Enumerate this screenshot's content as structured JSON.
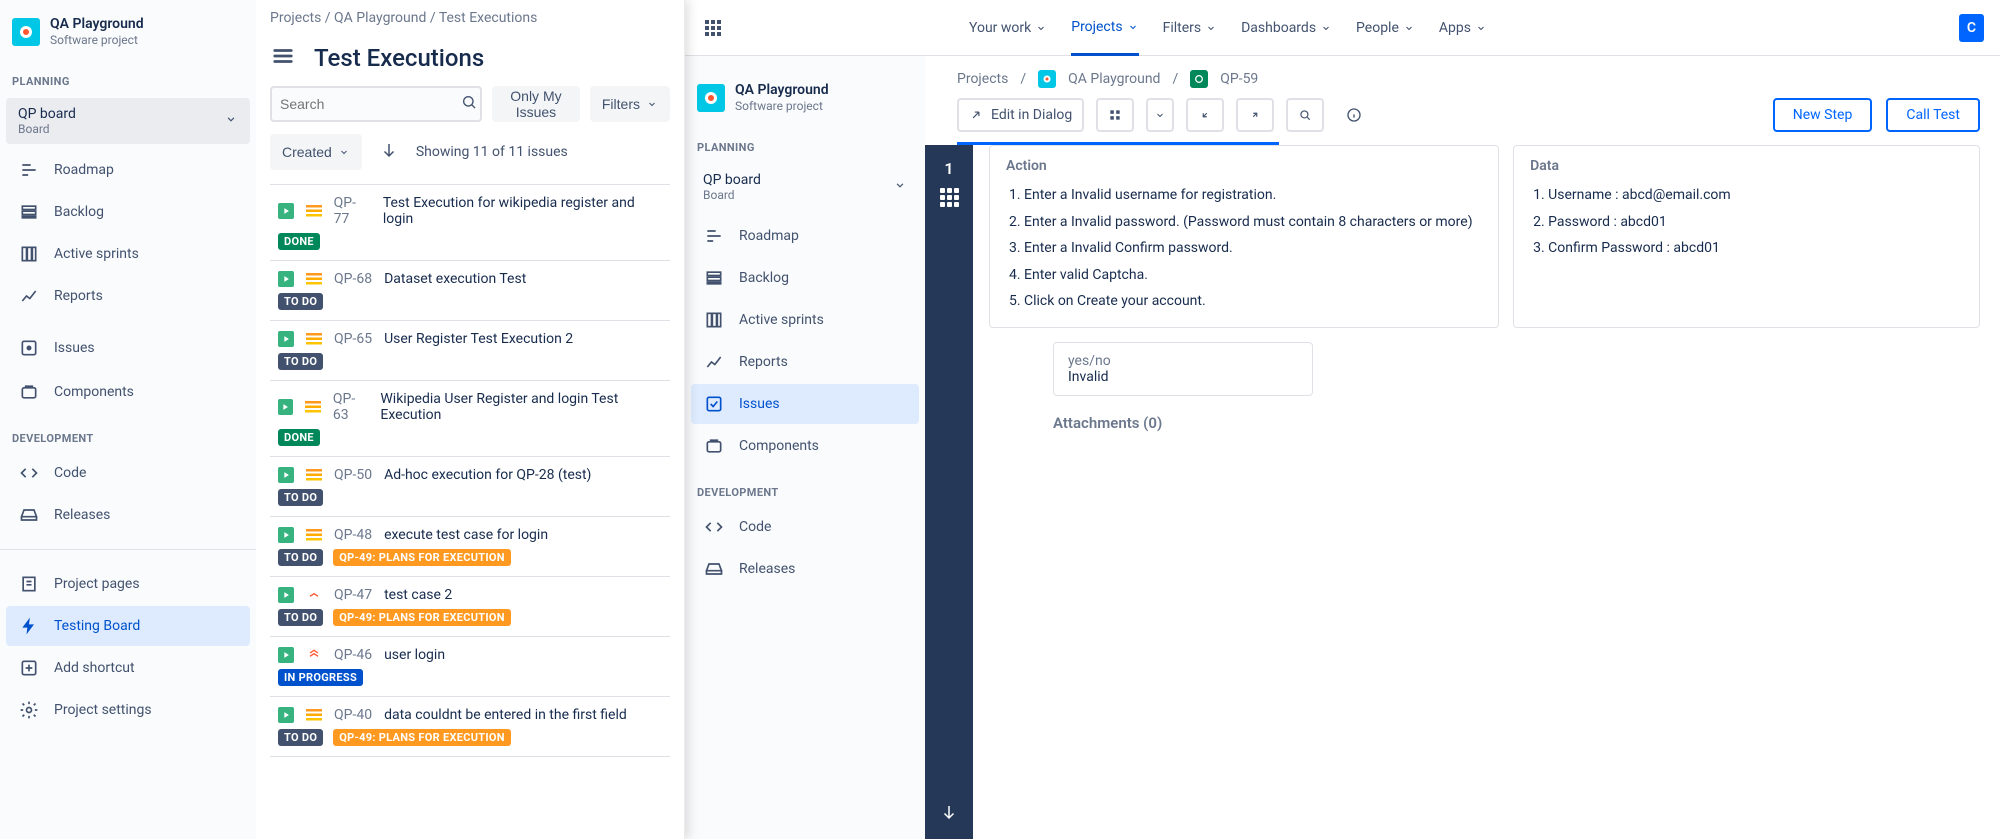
{
  "leftSidebar": {
    "project": {
      "name": "QA Playground",
      "type": "Software project"
    },
    "planningLabel": "PLANNING",
    "board": {
      "name": "QP board",
      "sub": "Board"
    },
    "planningItems": [
      "Roadmap",
      "Backlog",
      "Active sprints",
      "Reports"
    ],
    "issuesItem": "Issues",
    "componentsItem": "Components",
    "devLabel": "DEVELOPMENT",
    "devItems": [
      "Code",
      "Releases"
    ],
    "bottomItems": [
      "Project pages",
      "Testing Board",
      "Add shortcut",
      "Project settings"
    ]
  },
  "leftMain": {
    "breadcrumb": [
      "Projects",
      "QA Playground",
      "Test Executions"
    ],
    "pageTitle": "Test Executions",
    "searchPlaceholder": "Search",
    "onlyMy": "Only My Issues",
    "filters": "Filters",
    "created": "Created",
    "showing": "Showing 11 of 11 issues",
    "issues": [
      {
        "key": "QP-77",
        "title": "Test Execution for wikipedia register and login",
        "status": "DONE",
        "prio": "medium",
        "tags": []
      },
      {
        "key": "QP-68",
        "title": "Dataset execution Test",
        "status": "TO DO",
        "prio": "medium",
        "tags": []
      },
      {
        "key": "QP-65",
        "title": "User Register Test Execution 2",
        "status": "TO DO",
        "prio": "medium",
        "tags": []
      },
      {
        "key": "QP-63",
        "title": "Wikipedia User Register and login Test Execution",
        "status": "DONE",
        "prio": "medium",
        "tags": []
      },
      {
        "key": "QP-50",
        "title": "Ad-hoc execution for QP-28 (test)",
        "status": "TO DO",
        "prio": "medium",
        "tags": []
      },
      {
        "key": "QP-48",
        "title": "execute test case for login",
        "status": "TO DO",
        "prio": "medium",
        "tags": [
          "QP-49: PLANS FOR EXECUTION"
        ]
      },
      {
        "key": "QP-47",
        "title": "test case 2",
        "status": "TO DO",
        "prio": "high",
        "tags": [
          "QP-49: PLANS FOR EXECUTION"
        ]
      },
      {
        "key": "QP-46",
        "title": "user login",
        "status": "IN PROGRESS",
        "prio": "highest",
        "tags": []
      },
      {
        "key": "QP-40",
        "title": "data couldnt be entered in the first field",
        "status": "TO DO",
        "prio": "medium",
        "tags": [
          "QP-49: PLANS FOR EXECUTION"
        ]
      }
    ]
  },
  "topnav": {
    "items": [
      "Your work",
      "Projects",
      "Filters",
      "Dashboards",
      "People",
      "Apps"
    ],
    "activeIndex": 1,
    "create": "C"
  },
  "rightSidebar": {
    "project": {
      "name": "QA Playground",
      "type": "Software project"
    },
    "planningLabel": "PLANNING",
    "board": {
      "name": "QP board",
      "sub": "Board"
    },
    "planningItems": [
      "Roadmap",
      "Backlog",
      "Active sprints",
      "Reports",
      "Issues",
      "Components"
    ],
    "activeIndex": 4,
    "devLabel": "DEVELOPMENT",
    "devItems": [
      "Code",
      "Releases"
    ]
  },
  "detail": {
    "breadcrumbProjects": "Projects",
    "breadcrumbProject": "QA Playground",
    "breadcrumbKey": "QP-59",
    "editInDialog": "Edit in Dialog",
    "newStep": "New Step",
    "callTest": "Call Test",
    "stepNum": "1",
    "actionLabel": "Action",
    "dataLabel": "Data",
    "actions": [
      "Enter a Invalid username for registration.",
      "Enter a Invalid password. (Password must contain 8 characters or more)",
      "Enter a Invalid Confirm password.",
      "Enter valid Captcha.",
      "Click on Create your account."
    ],
    "data": [
      "Username : abcd@email.com",
      "Password : abcd01",
      "Confirm Password : abcd01"
    ],
    "yesnoLabel": "yes/no",
    "yesnoValue": "Invalid",
    "attachments": "Attachments (0)"
  }
}
